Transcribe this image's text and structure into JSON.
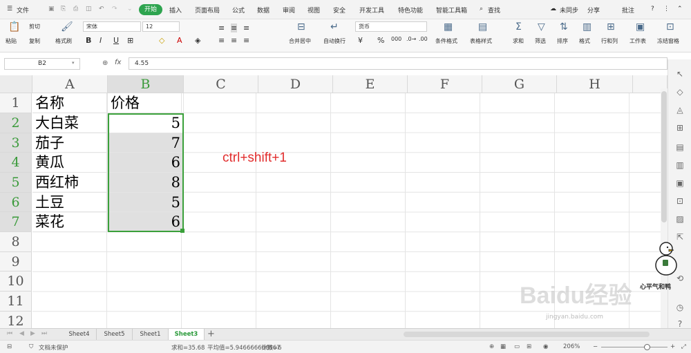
{
  "menu": {
    "file": "文件",
    "items": [
      "插入",
      "页面布局",
      "公式",
      "数据",
      "审阅",
      "视图",
      "安全",
      "开发工具",
      "特色功能",
      "智能工具箱"
    ],
    "start": "开始",
    "search": "查找",
    "sync": "未同步",
    "share": "分享",
    "comment": "批注"
  },
  "ribbon": {
    "paste": "粘贴",
    "cut": "剪切",
    "copy": "复制",
    "format_painter": "格式刷",
    "font": "宋体",
    "size": "12",
    "numfmt": "货币",
    "merge": "合并居中",
    "wrap": "自动换行",
    "cond_format": "条件格式",
    "table_style": "表格样式",
    "sum": "求和",
    "filter": "筛选",
    "sort": "排序",
    "format": "格式",
    "rowcol": "行和列",
    "worksheet": "工作表",
    "freeze": "冻结窗格"
  },
  "formula": {
    "cell_ref": "B2",
    "fx": "fx",
    "value": "4.55"
  },
  "columns": [
    "A",
    "B",
    "C",
    "D",
    "E",
    "F",
    "G",
    "H"
  ],
  "rows": [
    "1",
    "2",
    "3",
    "4",
    "5",
    "6",
    "7",
    "8",
    "9",
    "10",
    "11",
    "12"
  ],
  "cells": {
    "A1": "名称",
    "B1": "价格",
    "A2": "大白菜",
    "B2": "5",
    "A3": "茄子",
    "B3": "7",
    "A4": "黄瓜",
    "B4": "6",
    "A5": "西红柿",
    "B5": "8",
    "A6": "土豆",
    "B6": "5",
    "A7": "菜花",
    "B7": "6"
  },
  "annotation": "ctrl+shift+1",
  "sheets": [
    "Sheet4",
    "Sheet5",
    "Sheet1",
    "Sheet3"
  ],
  "active_sheet": "Sheet3",
  "status": {
    "protect": "文档未保护",
    "sum": "求和=35.68",
    "avg": "平均值=5.946666666667",
    "count": "计数=6",
    "zoom": "206%"
  },
  "watermark": {
    "logo": "Baidu经验",
    "url": "jingyan.baidu.com",
    "duck_caption": "心平气和鸭"
  },
  "colors": {
    "accent": "#2ea44f",
    "annotation": "#e12c2c"
  }
}
